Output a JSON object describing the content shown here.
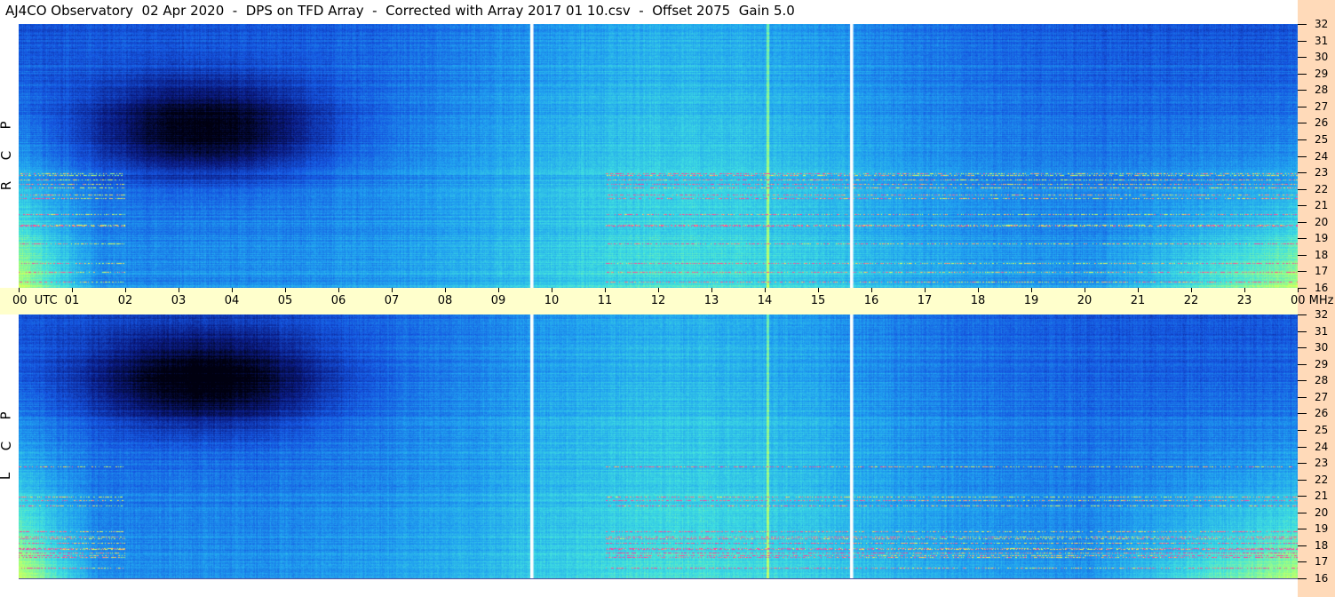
{
  "title": "AJ4CO Observatory  02 Apr 2020  -  DPS on TFD Array  -  Corrected with Array 2017 01 10.csv  -  Offset 2075  Gain 5.0",
  "panels": [
    {
      "name": "RCP",
      "letters": [
        "P",
        "C",
        "R"
      ]
    },
    {
      "name": "LCP",
      "letters": [
        "P",
        "C",
        "L"
      ]
    }
  ],
  "time_axis": {
    "labels": [
      "00  UTC",
      "01",
      "02",
      "03",
      "04",
      "05",
      "06",
      "07",
      "08",
      "09",
      "10",
      "11",
      "12",
      "13",
      "14",
      "15",
      "16",
      "17",
      "18",
      "19",
      "20",
      "21",
      "22",
      "23",
      "00 MHz"
    ]
  },
  "freq_axis": {
    "labels": [
      "32",
      "31",
      "30",
      "29",
      "28",
      "27",
      "26",
      "25",
      "24",
      "23",
      "22",
      "21",
      "20",
      "19",
      "18",
      "17",
      "16"
    ]
  },
  "chart_data": {
    "type": "heatmap",
    "title": "AJ4CO Observatory  02 Apr 2020  -  DPS on TFD Array  -  Corrected with Array 2017 01 10.csv  -  Offset 2075  Gain 5.0",
    "x_unit": "UTC hour",
    "x_range": [
      0,
      24
    ],
    "y_unit": "MHz",
    "y_range": [
      16,
      32
    ],
    "series": [
      {
        "name": "RCP"
      },
      {
        "name": "LCP"
      }
    ],
    "colormap": [
      "#000010",
      "#0a1a80",
      "#1555e0",
      "#20a0f0",
      "#40e0e0",
      "#a0ff80",
      "#ffff40",
      "#ff40a0"
    ]
  }
}
